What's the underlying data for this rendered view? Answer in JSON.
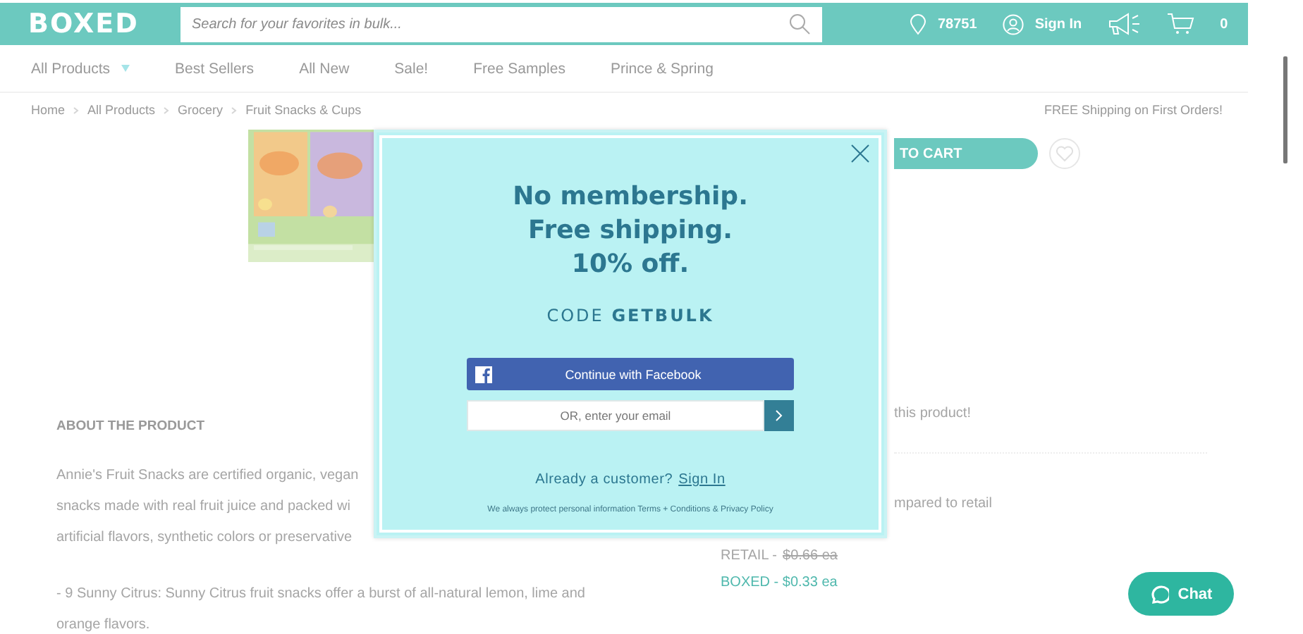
{
  "header": {
    "logo": "BOXED",
    "search": {
      "placeholder": "Search for your favorites in bulk..."
    },
    "zip": "78751",
    "sign_in": "Sign In",
    "cart_count": "0"
  },
  "nav": {
    "items": [
      {
        "label": "All Products",
        "kind": "dropdown"
      },
      {
        "label": "Best Sellers",
        "kind": "link"
      },
      {
        "label": "All New",
        "kind": "link"
      },
      {
        "label": "Sale!",
        "kind": "link"
      },
      {
        "label": "Free Samples",
        "kind": "link"
      },
      {
        "label": "Prince & Spring",
        "kind": "link"
      }
    ]
  },
  "breadcrumb": [
    "Home",
    "All Products",
    "Grocery",
    "Fruit Snacks & Cups"
  ],
  "promo": "FREE Shipping on First Orders!",
  "product": {
    "add_to_cart": "TO CART",
    "about_heading": "ABOUT THE PRODUCT",
    "description_lines": [
      "Annie's Fruit Snacks are certified organic, vegan",
      "snacks made with real fruit juice and packed wi",
      "artificial flavors, synthetic colors or preservative"
    ],
    "bullet_lines": [
      "- 9 Sunny Citrus: Sunny Citrus fruit snacks offer a burst of all-natural lemon, lime and",
      "orange flavors."
    ],
    "review_fragment": "this product!",
    "savings_fragment": "mpared to retail",
    "retail_label": "RETAIL -",
    "retail_price": "$0.66 ea",
    "boxed_price": "BOXED - $0.33 ea"
  },
  "modal": {
    "headline_lines": [
      "No membership.",
      "Free shipping.",
      "10% off."
    ],
    "code": "CODE **GETBULK**",
    "facebook_button": "Continue with Facebook",
    "email": {
      "placeholder": "OR, enter your email"
    },
    "existing_prompt": "Already a customer?",
    "sign_in_link": "Sign In",
    "fine_print": "We always protect personal information Terms + Conditions & Privacy Policy"
  },
  "chat": "Chat"
}
